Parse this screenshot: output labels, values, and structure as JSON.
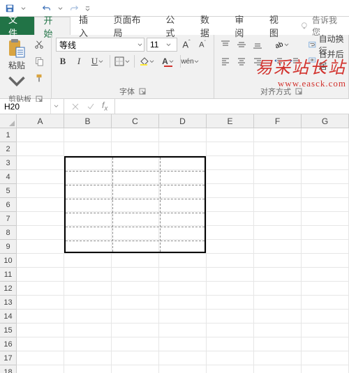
{
  "qat": {
    "save": "save-icon",
    "undo": "undo-icon",
    "redo": "redo-icon"
  },
  "tabs": {
    "file": "文件",
    "items": [
      "开始",
      "插入",
      "页面布局",
      "公式",
      "数据",
      "审阅",
      "视图"
    ],
    "active_index": 0,
    "tell_me": "告诉我您"
  },
  "ribbon": {
    "clipboard": {
      "paste": "粘贴",
      "label": "剪贴板"
    },
    "font": {
      "name": "等线",
      "size": "11",
      "bold": "B",
      "italic": "I",
      "underline": "U",
      "wen": "wén",
      "label": "字体"
    },
    "alignment": {
      "wrap": "自动换行",
      "merge": "合并后居",
      "label": "对齐方式"
    }
  },
  "namebox": {
    "ref": "H20"
  },
  "grid": {
    "cols": [
      "A",
      "B",
      "C",
      "D",
      "E",
      "F",
      "G"
    ],
    "rows": [
      "1",
      "2",
      "3",
      "4",
      "5",
      "6",
      "7",
      "8",
      "9",
      "10",
      "11",
      "12",
      "13",
      "14",
      "15",
      "16",
      "17",
      "18"
    ],
    "selection": {
      "c1": 1,
      "r1": 2,
      "c2": 3,
      "r2": 8
    }
  },
  "watermark": {
    "cn": "易采站长站",
    "en": "www.easck.com"
  }
}
